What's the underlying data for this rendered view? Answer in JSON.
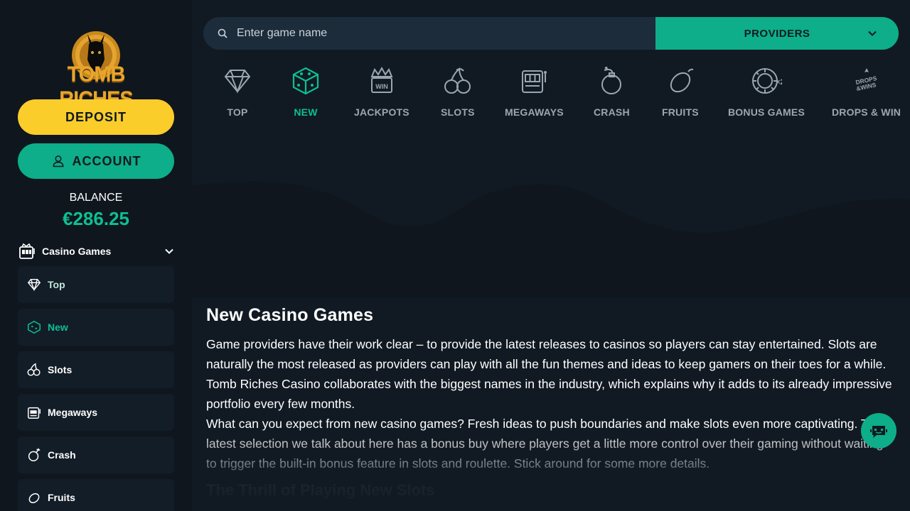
{
  "brand": {
    "logo_text": "TOMB RICHES"
  },
  "sidebar": {
    "deposit_label": "DEPOSIT",
    "account_label": "ACCOUNT",
    "balance_label": "BALANCE",
    "balance_value": "€286.25",
    "section_title": "Casino Games",
    "items": [
      {
        "label": "Top",
        "icon": "diamond-icon"
      },
      {
        "label": "New",
        "icon": "dice-icon",
        "active": true
      },
      {
        "label": "Slots",
        "icon": "cherries-icon"
      },
      {
        "label": "Megaways",
        "icon": "slot-machine-icon"
      },
      {
        "label": "Crash",
        "icon": "bomb-icon"
      },
      {
        "label": "Fruits",
        "icon": "lemon-icon"
      }
    ]
  },
  "search": {
    "placeholder": "Enter game name",
    "providers_label": "PROVIDERS"
  },
  "categories": [
    {
      "label": "TOP",
      "icon": "diamond-icon"
    },
    {
      "label": "NEW",
      "icon": "dice-icon",
      "active": true
    },
    {
      "label": "JACKPOTS",
      "icon": "jackpot-crown-icon"
    },
    {
      "label": "SLOTS",
      "icon": "cherries-icon"
    },
    {
      "label": "MEGAWAYS",
      "icon": "slot-machine-icon"
    },
    {
      "label": "CRASH",
      "icon": "bomb-icon"
    },
    {
      "label": "FRUITS",
      "icon": "lemon-icon"
    },
    {
      "label": "BONUS GAMES",
      "icon": "bonus-chip-icon"
    },
    {
      "label": "DROPS & WIN",
      "icon": "drops-wins-icon"
    }
  ],
  "content": {
    "title": "New Casino Games",
    "paragraph1": "Game providers have their work clear – to provide the latest releases to casinos so players can stay entertained. Slots are naturally the most released as providers can play with all the fun themes and ideas to keep gamers on their toes for a while. Tomb Riches Casino collaborates with the biggest names in the industry, which explains why it adds to its already impressive portfolio every few months.",
    "paragraph2": "What can you expect from new casino games? Fresh ideas to push boundaries and make slots even more captivating. The latest selection we talk about here has a bonus buy where players get a little more control over their gaming without waiting to trigger the built-in bonus feature in slots and roulette. Stick around for some more details.",
    "next_heading": "The Thrill of Playing New Slots"
  },
  "colors": {
    "accent": "#0dae89",
    "deposit": "#fbcd2b",
    "background": "#111a23",
    "sidebar": "#0f161e"
  }
}
